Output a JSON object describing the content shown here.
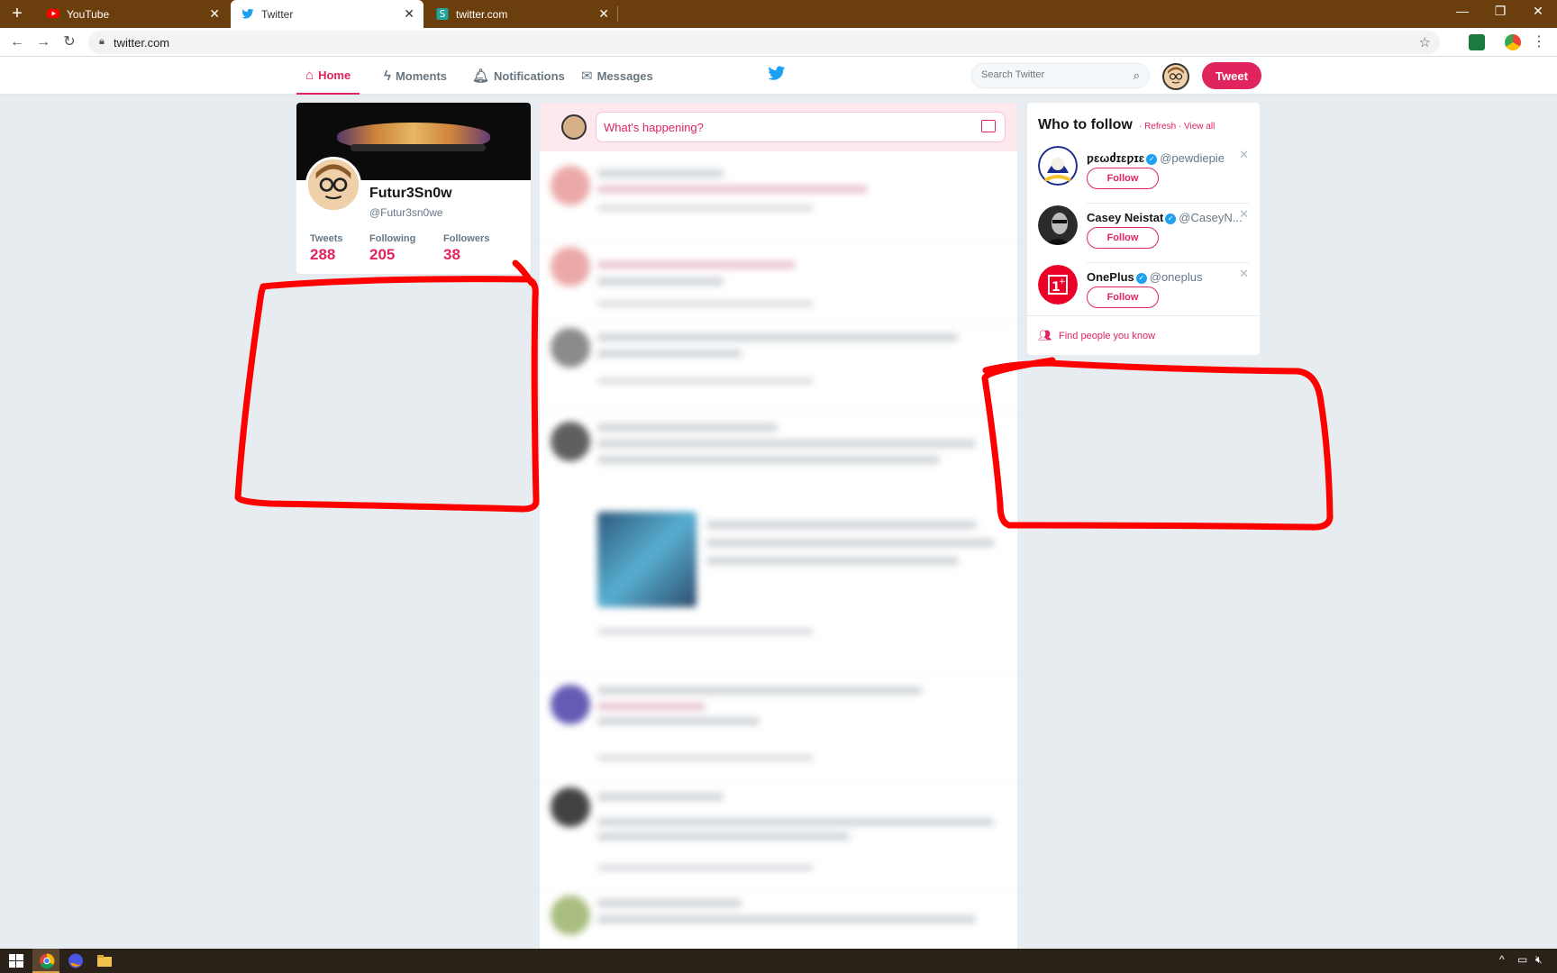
{
  "browser": {
    "tabs": [
      {
        "title": "YouTube",
        "icon": "youtube-icon",
        "active": false
      },
      {
        "title": "Twitter",
        "icon": "twitter-icon",
        "active": true
      },
      {
        "title": "twitter.com",
        "icon": "s-extension-icon",
        "active": false
      }
    ],
    "url": "twitter.com"
  },
  "nav": {
    "home": "Home",
    "moments": "Moments",
    "notifications": "Notifications",
    "messages": "Messages",
    "search_placeholder": "Search Twitter",
    "tweet_button": "Tweet"
  },
  "profile": {
    "name": "Futur3Sn0w",
    "handle": "@Futur3sn0we",
    "stats": [
      {
        "label": "Tweets",
        "value": "288"
      },
      {
        "label": "Following",
        "value": "205"
      },
      {
        "label": "Followers",
        "value": "38"
      }
    ]
  },
  "compose": {
    "placeholder": "What's happening?"
  },
  "who_to_follow": {
    "title": "Who to follow",
    "refresh": "Refresh",
    "view_all": "View all",
    "accounts": [
      {
        "name": "ƿɛωძɪɛƿɪɛ",
        "handle": "@pewdiepie",
        "follow": "Follow"
      },
      {
        "name": "Casey Neistat",
        "handle": "@CaseyN...",
        "follow": "Follow"
      },
      {
        "name": "OnePlus",
        "handle": "@oneplus",
        "follow": "Follow"
      }
    ],
    "find_people": "Find people you know"
  },
  "colors": {
    "accent": "#e0245e",
    "twitter_blue": "#1da1f2",
    "tabbar": "#6b3e0d",
    "annotation": "#ff0000"
  }
}
